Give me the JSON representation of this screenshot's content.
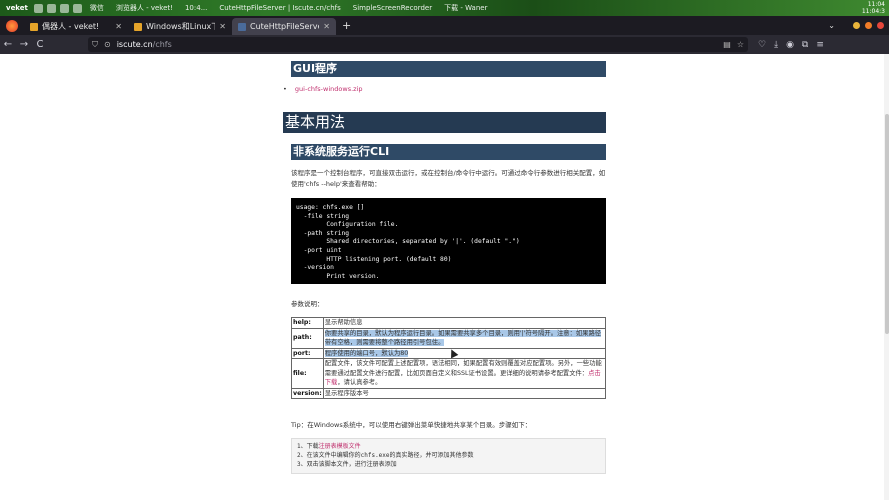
{
  "os_panel": {
    "app_label": "veket",
    "tasks": [
      "微信",
      "浏览器人 - veket!",
      "10:4...",
      "CuteHttpFileServer | Iscute.cn/chfs",
      "SimpleScreenRecorder",
      "下载 - Waner"
    ],
    "clock_line1": "11:04",
    "clock_line2": "11:04:3"
  },
  "tabs": [
    {
      "label": "偶器人 - veket!",
      "close": "✕"
    },
    {
      "label": "Windows和Linux下的文",
      "close": "✕"
    },
    {
      "label": "CuteHttpFileServer | Iscute",
      "close": "✕"
    }
  ],
  "tabbar": {
    "new_tab": "+",
    "list_all": "⌄"
  },
  "window_dots": [
    "#e9b53b",
    "#f07c28",
    "#e5463b"
  ],
  "navbar": {
    "back": "←",
    "forward": "→",
    "reload": "C",
    "url_host": "iscute.cn",
    "url_path": "/chfs",
    "reader_icon": "reader-icon",
    "bookmark_icon": "star-icon"
  },
  "page": {
    "gui_heading": "GUI程序",
    "gui_link": "gui-chfs-windows.zip",
    "basic_heading": "基本用法",
    "cli_heading": "非系统服务运行CLI",
    "intro_line1": "该程序是一个控制台程序，可直接双击运行，或在控制台/命令行中运行。可通过命令行参数进行相关配置，如",
    "intro_line2": "使用'chfs --help'来查看帮助：",
    "code": "usage: chfs.exe []\n  -file string\n        Configuration file.\n  -path string\n        Shared directories, separated by '|'. (default \".\")\n  -port uint\n        HTTP listening port. (default 80)\n  -version\n        Print version.",
    "params_label": "参数说明：",
    "params": [
      {
        "key": "help:",
        "desc": "显示帮助信息"
      },
      {
        "key": "path:",
        "desc": "你要共享的目录，默认为程序运行目录。如果需要共享多个目录，则用'|'符号隔开。注意：如果路径带有空格，则需要将整个路径用引号包住。"
      },
      {
        "key": "port:",
        "desc": "程序使用的端口号，默认为80"
      },
      {
        "key": "file:",
        "desc_pre": "配置文件，该文件可配置上述配置项，语法相同，如果配置有效则覆盖对应配置项。另外，一些功能需要通过配置文件进行配置，比如页面自定义和SSL证书设置。更详细的说明请参考配置文件：",
        "desc_link": "点击下载",
        "desc_post": "，请认真参考。"
      },
      {
        "key": "version:",
        "desc": "显示程序版本号"
      }
    ],
    "tip": "Tip：在Windows系统中，可以使用右键弹出菜单快捷地共享某个目录。步骤如下：",
    "steps": [
      {
        "num": "1、",
        "pre": "下载",
        "link": "注册表模板文件",
        "post": ""
      },
      {
        "num": "2、",
        "pre": "在该文件中编辑你的chfs.exe的真实路径，并可添加其他参数",
        "link": "",
        "post": ""
      },
      {
        "num": "3、",
        "pre": "双击该脚本文件，进行注册表添加",
        "link": "",
        "post": ""
      }
    ]
  }
}
